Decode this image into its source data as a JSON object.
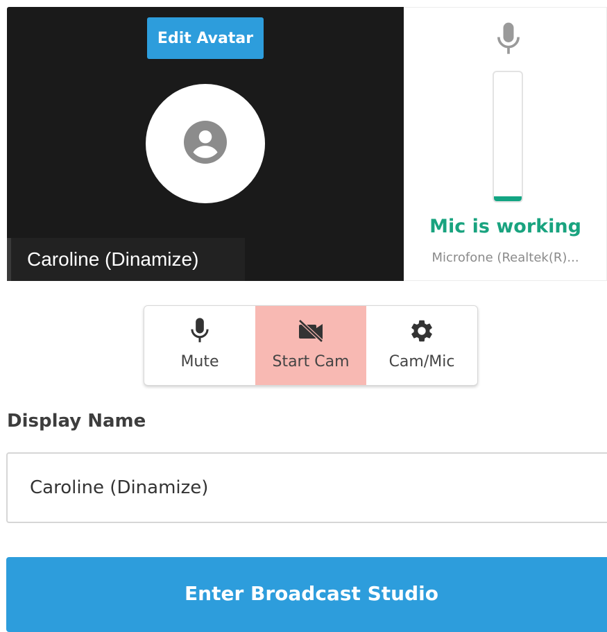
{
  "preview": {
    "edit_avatar_label": "Edit Avatar",
    "participant_name": "Caroline (Dinamize)",
    "avatar_icon": "account-circle-icon"
  },
  "mic": {
    "icon": "microphone-icon",
    "status": "Mic is working",
    "device": "Microfone (Realtek(R)...",
    "level": 0.04,
    "status_color": "#19a37f"
  },
  "controls": [
    {
      "label": "Mute",
      "icon": "microphone-icon"
    },
    {
      "label": "Start Cam",
      "icon": "camera-off-icon",
      "active": true
    },
    {
      "label": "Cam/Mic",
      "icon": "gear-icon"
    }
  ],
  "display_name": {
    "label": "Display Name",
    "value": "Caroline (Dinamize)"
  },
  "enter_button": "Enter Broadcast Studio",
  "colors": {
    "accent": "#2d9ddc",
    "active_control": "#f8b9b3",
    "preview_bg": "#1a1a1a"
  }
}
